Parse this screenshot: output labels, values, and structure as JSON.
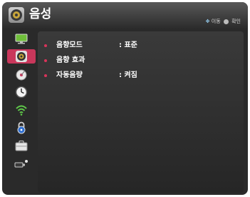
{
  "header": {
    "title": "음성",
    "title_icon": "speaker-icon",
    "hint_move": "이동",
    "hint_confirm": "확인"
  },
  "sidebar": {
    "items": [
      {
        "icon": "monitor-icon"
      },
      {
        "icon": "speaker-icon",
        "active": true
      },
      {
        "icon": "satellite-dish-icon"
      },
      {
        "icon": "clock-icon"
      },
      {
        "icon": "wifi-icon"
      },
      {
        "icon": "lock-icon"
      },
      {
        "icon": "toolbox-icon"
      },
      {
        "icon": "input-source-icon"
      }
    ]
  },
  "menu": {
    "items": [
      {
        "label": "음향모드",
        "value": ": 표준"
      },
      {
        "label": "음향 효과",
        "value": ""
      },
      {
        "label": "자동음량",
        "value": ": 켜짐"
      }
    ]
  },
  "colors": {
    "accent": "#c9375b",
    "bullet": "#d9335a",
    "panel": "#2a2a2a"
  }
}
